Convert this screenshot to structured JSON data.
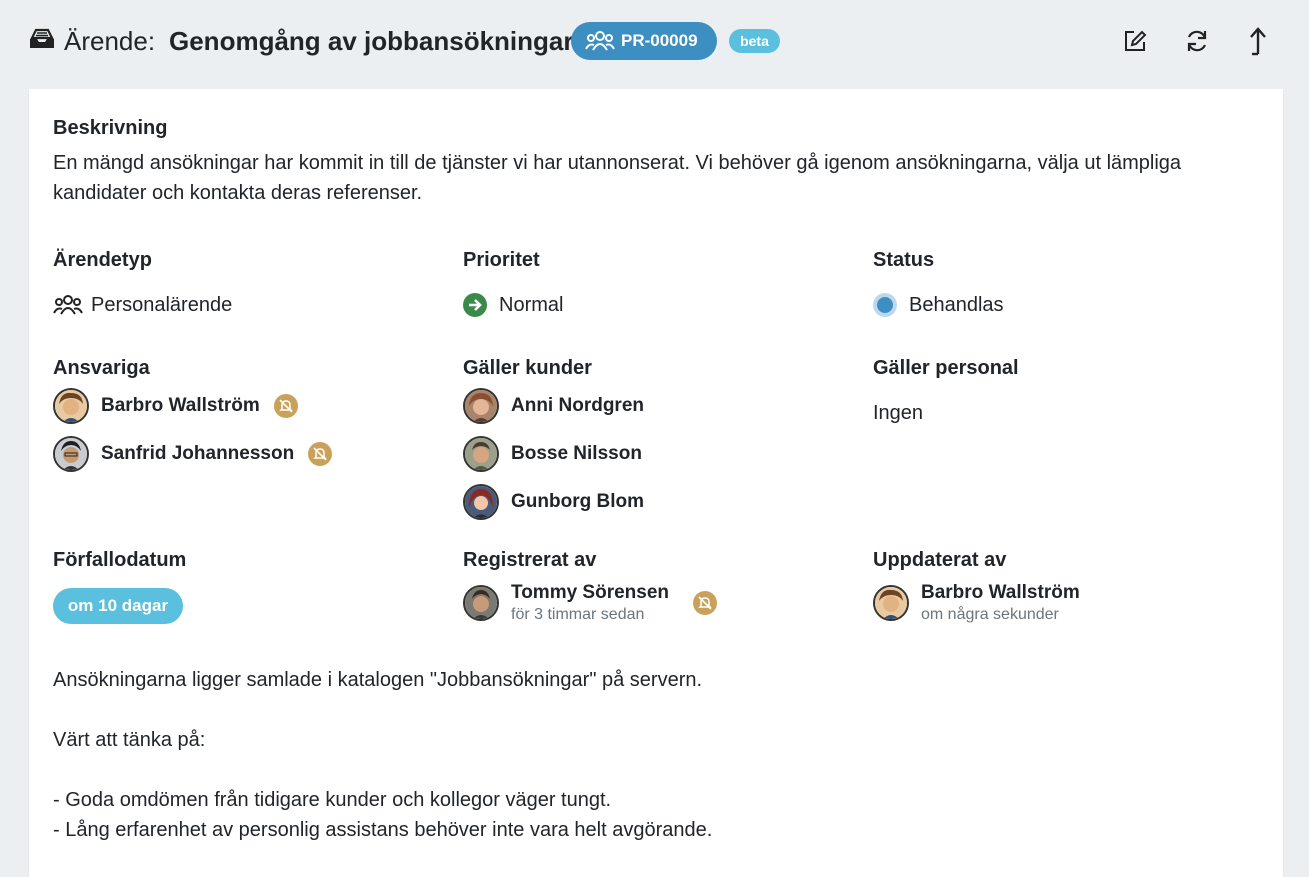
{
  "header": {
    "icon": "inbox-icon",
    "prefix": "Ärende:",
    "title": "Genomgång av jobbansökningar",
    "case_id": "PR-00009",
    "beta": "beta",
    "actions": [
      "edit-icon",
      "refresh-icon",
      "share-icon"
    ]
  },
  "description": {
    "label": "Beskrivning",
    "line1": "En mängd ansökningar har kommit in till de tjänster vi har utannonserat. Vi behöver gå igenom ansökningarna, välja ut lämpliga",
    "line2": "kandidater och kontakta deras referenser."
  },
  "case_type": {
    "label": "Ärendetyp",
    "value": "Personalärende"
  },
  "priority": {
    "label": "Prioritet",
    "value": "Normal",
    "color": "#3a8a4a"
  },
  "status": {
    "label": "Status",
    "value": "Behandlas",
    "color": "#3d8ec1"
  },
  "responsible": {
    "label": "Ansvariga",
    "people": [
      {
        "name": "Barbro Wallström"
      },
      {
        "name": "Sanfrid Johannesson"
      }
    ]
  },
  "customers": {
    "label": "Gäller kunder",
    "people": [
      {
        "name": "Anni Nordgren"
      },
      {
        "name": "Bosse Nilsson"
      },
      {
        "name": "Gunborg Blom"
      }
    ]
  },
  "staff": {
    "label": "Gäller personal",
    "value": "Ingen"
  },
  "due": {
    "label": "Förfallodatum",
    "value": "om 10 dagar"
  },
  "registered": {
    "label": "Registrerat av",
    "name": "Tommy Sörensen",
    "time": "för 3 timmar sedan"
  },
  "updated": {
    "label": "Uppdaterat av",
    "name": "Barbro Wallström",
    "time": "om några sekunder"
  },
  "notes": {
    "line1": "Ansökningarna ligger samlade i katalogen \"Jobbansökningar\" på servern.",
    "line2": "Värt att tänka på:",
    "line3": "- Goda omdömen från tidigare kunder och kollegor väger tungt.",
    "line4": "- Lång erfarenhet av personlig assistans behöver inte vara helt avgörande."
  }
}
